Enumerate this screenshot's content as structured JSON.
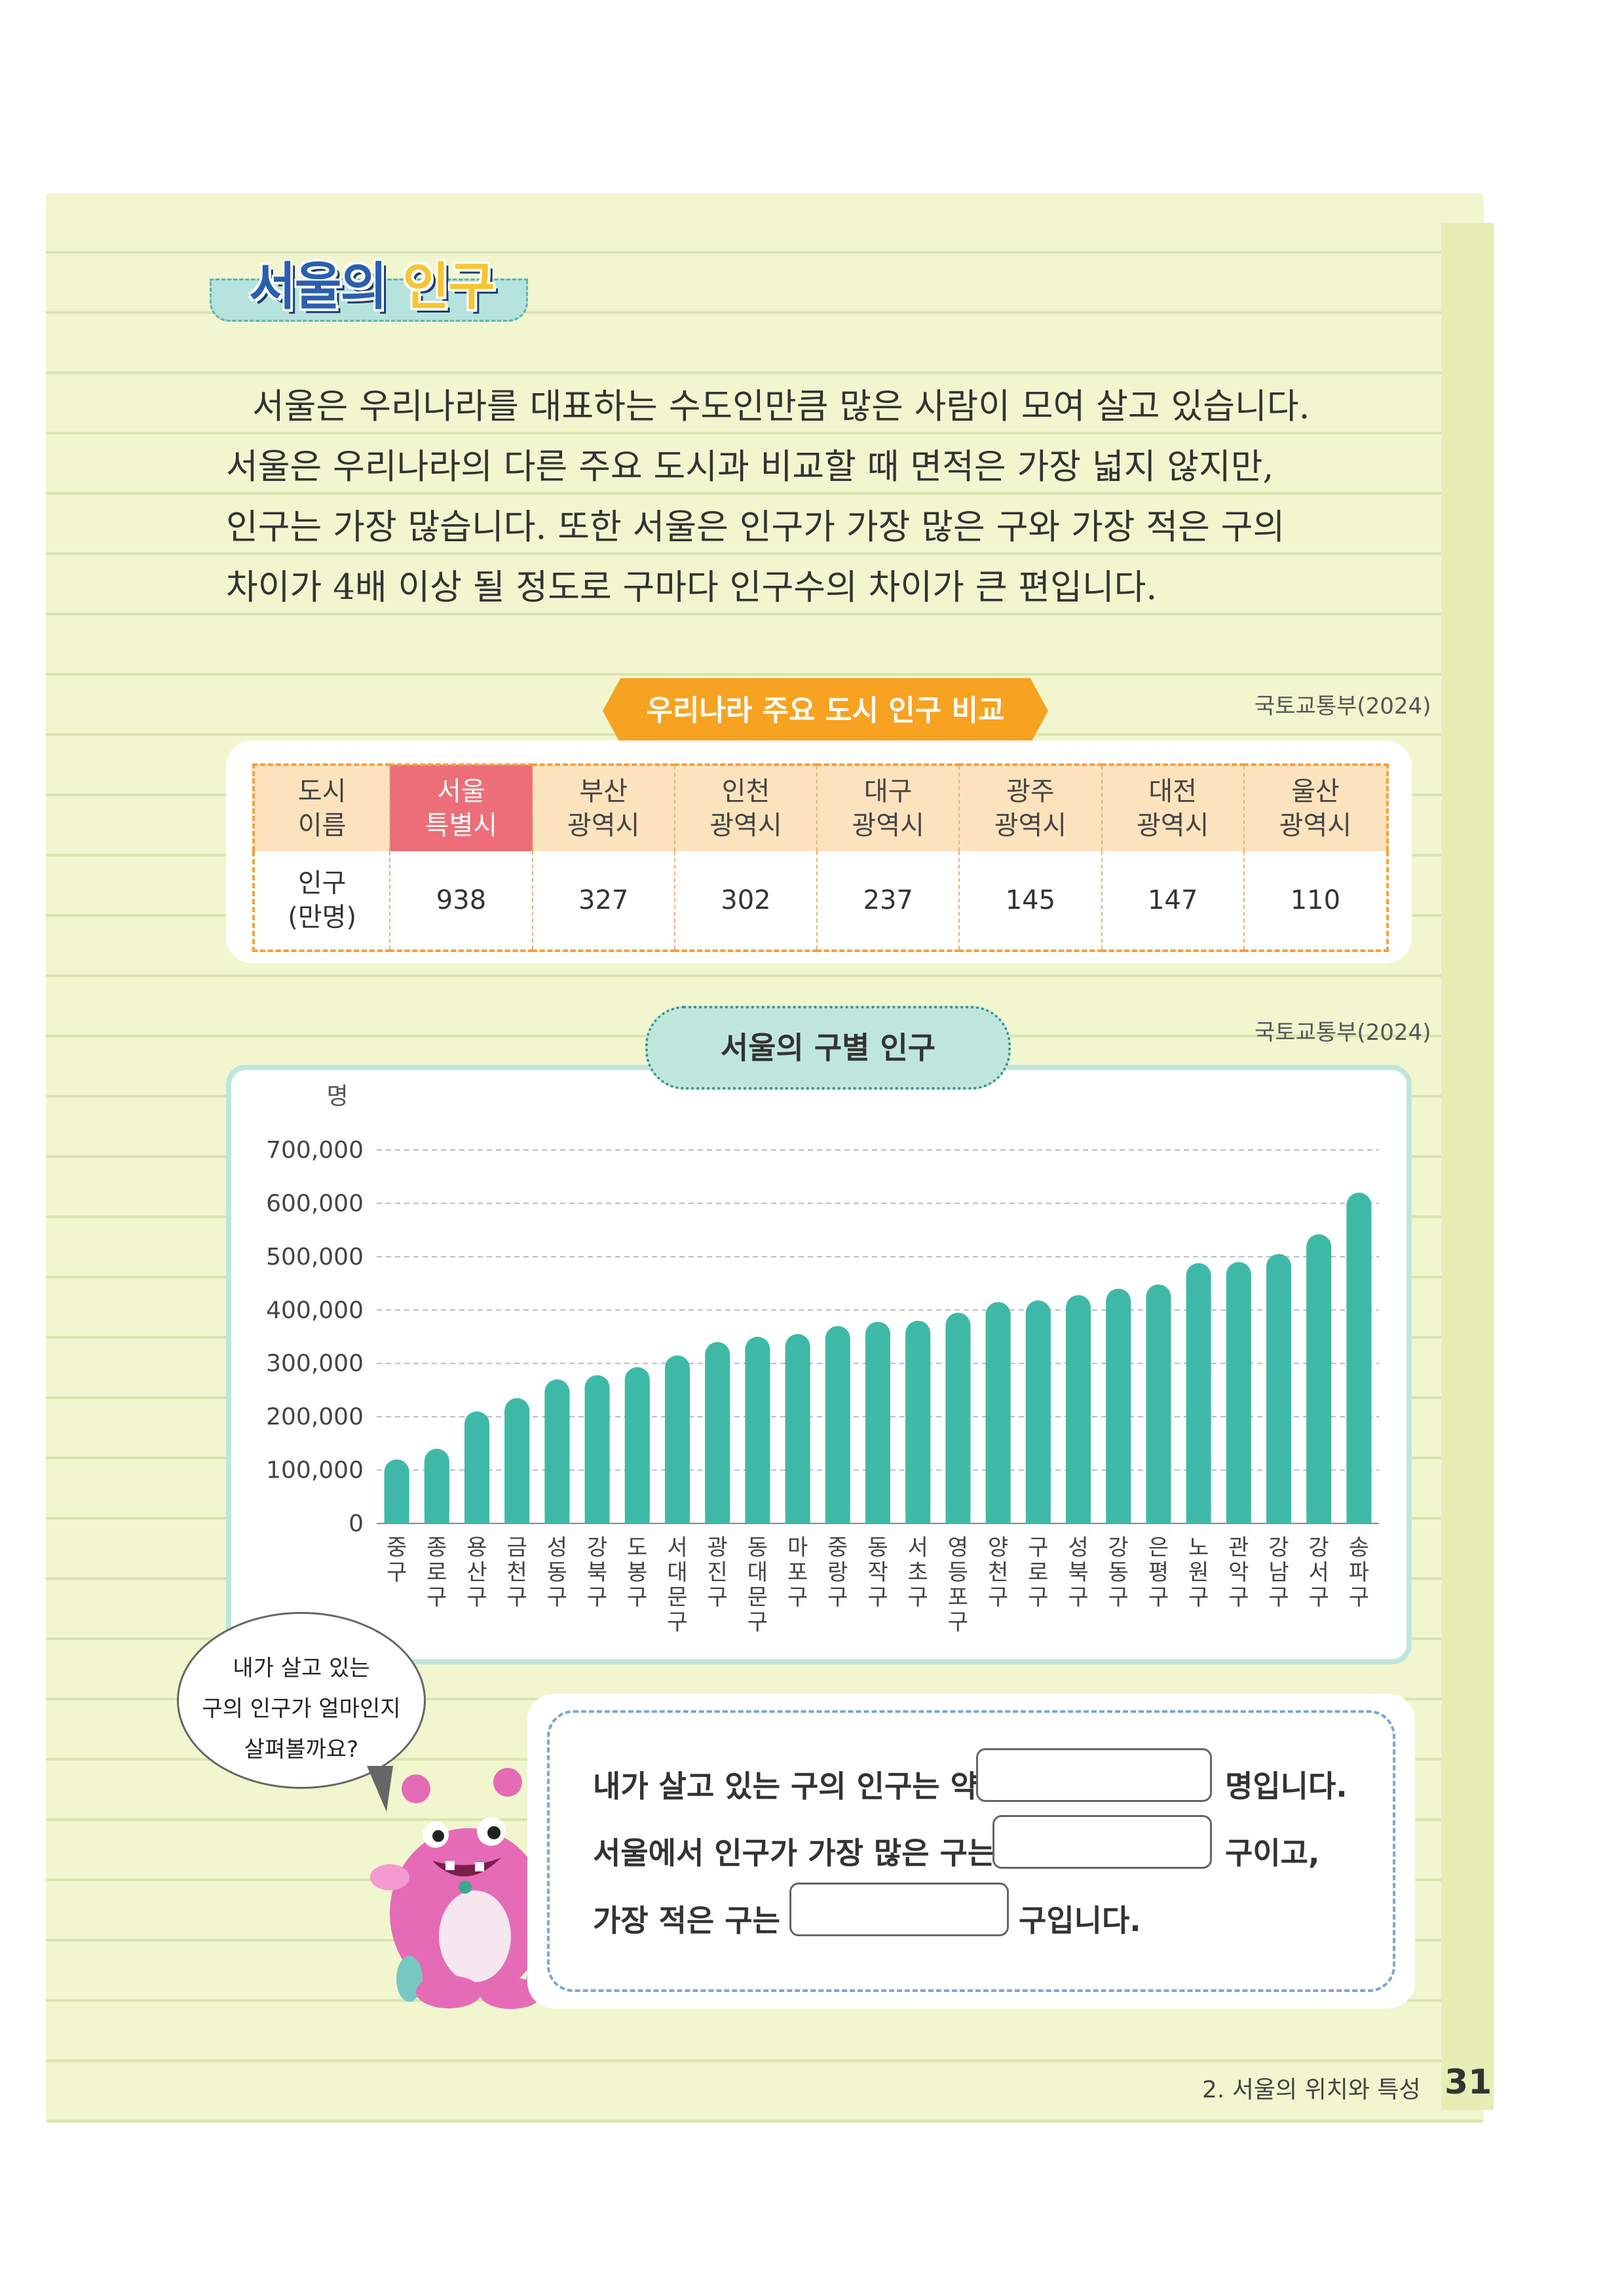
{
  "section": {
    "title_part1": "서울의 ",
    "title_part2": "인구"
  },
  "paragraph": [
    "서울은 우리나라를 대표하는 수도인만큼 많은 사람이 모여 살고 있습니다.",
    "서울은 우리나라의 다른 주요 도시과 비교할 때 면적은 가장 넓지 않지만,",
    "인구는 가장 많습니다. 또한 서울은 인구가 가장 많은 구와 가장 적은 구의",
    "차이가 4배 이상 될 정도로 구마다 인구수의 차이가 큰 편입니다."
  ],
  "city_table": {
    "title": "우리나라 주요 도시 인구 비교",
    "source": "국토교통부(2024)",
    "header_label": [
      "도시",
      "이름"
    ],
    "row_label": [
      "인구",
      "(만명)"
    ],
    "cities": [
      {
        "line1": "서울",
        "line2": "특별시",
        "value": "938"
      },
      {
        "line1": "부산",
        "line2": "광역시",
        "value": "327"
      },
      {
        "line1": "인천",
        "line2": "광역시",
        "value": "302"
      },
      {
        "line1": "대구",
        "line2": "광역시",
        "value": "237"
      },
      {
        "line1": "광주",
        "line2": "광역시",
        "value": "145"
      },
      {
        "line1": "대전",
        "line2": "광역시",
        "value": "147"
      },
      {
        "line1": "울산",
        "line2": "광역시",
        "value": "110"
      }
    ],
    "highlight_color": "#ed6d78"
  },
  "district_chart": {
    "title": "서울의 구별 인구",
    "source": "국토교통부(2024)"
  },
  "chart_data": {
    "type": "bar",
    "title": "서울의 구별 인구",
    "ylabel": "명",
    "xlabel": "",
    "ylim": [
      0,
      700000
    ],
    "yticks": [
      0,
      100000,
      200000,
      300000,
      400000,
      500000,
      600000,
      700000
    ],
    "ytick_labels": [
      "0",
      "100,000",
      "200,000",
      "300,000",
      "400,000",
      "500,000",
      "600,000",
      "700,000"
    ],
    "grid": true,
    "bar_color": "#3fb9a7",
    "categories": [
      "중구",
      "종로구",
      "용산구",
      "금천구",
      "성동구",
      "강북구",
      "도봉구",
      "서대문구",
      "광진구",
      "동대문구",
      "마포구",
      "중랑구",
      "동작구",
      "서초구",
      "영등포구",
      "양천구",
      "구로구",
      "성북구",
      "강동구",
      "은평구",
      "노원구",
      "관악구",
      "강남구",
      "강서구",
      "송파구"
    ],
    "values": [
      120000,
      140000,
      210000,
      235000,
      270000,
      278000,
      293000,
      315000,
      340000,
      350000,
      355000,
      370000,
      378000,
      380000,
      395000,
      415000,
      418000,
      428000,
      440000,
      448000,
      488000,
      490000,
      505000,
      542000,
      620000
    ]
  },
  "bubble": {
    "lines": [
      "내가 살고 있는",
      "구의 인구가 얼마인지",
      "살펴볼까요?"
    ]
  },
  "fill_in": {
    "line1_pre": "내가 살고 있는 구의 인구는 약",
    "line1_post": "명입니다.",
    "line2_pre": "서울에서 인구가 가장 많은 구는",
    "line2_post": "구이고,",
    "line3_pre": "가장 적은 구는",
    "line3_post": "구입니다."
  },
  "footer": {
    "chapter": "2. 서울의 위치와 특성",
    "page": "31"
  }
}
